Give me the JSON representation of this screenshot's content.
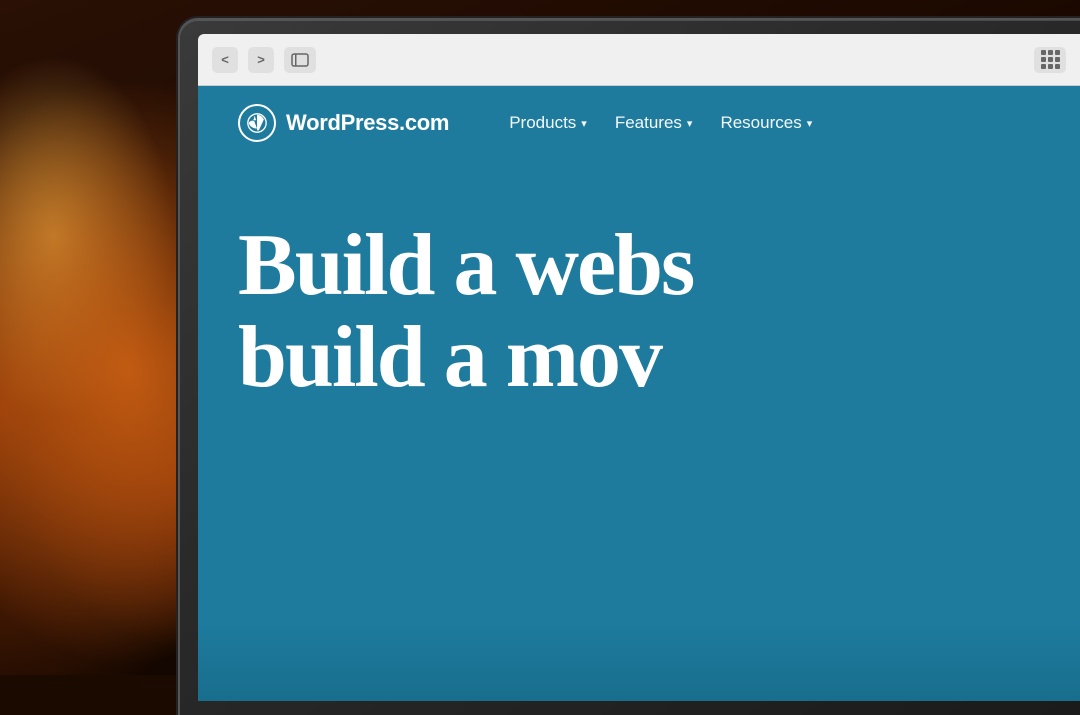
{
  "browser": {
    "back_btn": "<",
    "forward_btn": ">",
    "tab_btn": "□□",
    "add_tab_btn": "+"
  },
  "wordpress": {
    "logo_icon": "W",
    "logo_text": "WordPress.com",
    "nav": {
      "items": [
        {
          "label": "Products",
          "has_dropdown": true
        },
        {
          "label": "Features",
          "has_dropdown": true
        },
        {
          "label": "Resources",
          "has_dropdown": true
        }
      ]
    },
    "hero": {
      "line1": "Build a webs",
      "line2": "build a mov"
    }
  }
}
